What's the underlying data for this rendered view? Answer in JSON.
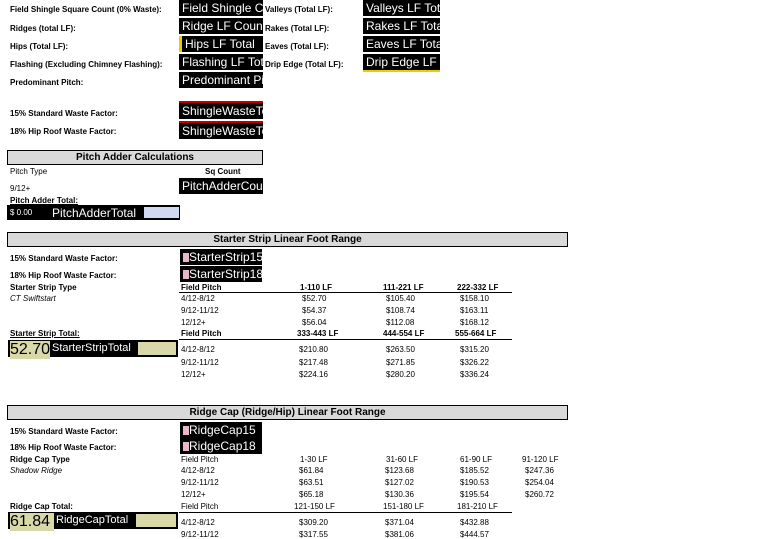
{
  "top_labels": {
    "field_shingle": "Field Shingle Square Count (0% Waste):",
    "ridges": "Ridges (total LF):",
    "hips": "Hips (Total LF):",
    "flashing": "Flashing (Excluding Chimney Flashing):",
    "predominant_pitch": "Predominant Pitch:",
    "waste15": "15% Standard Waste Factor:",
    "waste18": "18% Hip Roof Waste Factor:",
    "valleys": "Valleys (Total LF):",
    "rakes": "Rakes (Total LF):",
    "eaves": "Eaves (Total LF):",
    "drip_edge": "Drip Edge (Total LF):"
  },
  "top_fields": {
    "field_shingle": "Field Shingle Count",
    "ridges": "Ridge LF Count",
    "hips": "Hips LF Total",
    "flashing": "Flashing LF Total",
    "predominant_pitch": "Predominant Pitch",
    "waste15": "ShingleWasteTotal15",
    "waste18": "ShingleWasteTotal18",
    "valleys": "Valleys LF Total",
    "rakes": "Rakes LF Total",
    "eaves": "Eaves LF Total",
    "drip_edge": "Drip Edge LF Total"
  },
  "pitch_adder": {
    "title": "Pitch Adder Calculations",
    "col_pitch_type": "Pitch Type",
    "col_sq_count": "Sq Count",
    "row_label": "9/12+",
    "row_field": "PitchAdderCount",
    "total_label": "Pitch Adder Total:",
    "total_value": "$ 0.00",
    "total_field": "PitchAdderTotal"
  },
  "starter": {
    "title": "Starter Strip Linear Foot Range",
    "waste15": "15% Standard Waste Factor:",
    "waste18": "18% Hip Roof Waste Factor:",
    "field15": "StarterStrip15",
    "field18": "StarterStrip18",
    "type_label": "Starter Strip Type",
    "type_value": "CT Swiftstart",
    "total_label": "Starter Strip Total:",
    "total_value": "52.70",
    "total_field": "StarterStripTotal",
    "table1": {
      "headers": [
        "Field Pitch",
        "1-110 LF",
        "111-221 LF",
        "222-332 LF"
      ],
      "rows": [
        [
          "4/12-8/12",
          "$52.70",
          "$105.40",
          "$158.10"
        ],
        [
          "9/12-11/12",
          "$54.37",
          "$108.74",
          "$163.11"
        ],
        [
          "12/12+",
          "$56.04",
          "$112.08",
          "$168.12"
        ]
      ]
    },
    "table2": {
      "headers": [
        "Field Pitch",
        "333-443 LF",
        "444-554 LF",
        "555-664 LF"
      ],
      "rows": [
        [
          "4/12-8/12",
          "$210.80",
          "$263.50",
          "$315.20"
        ],
        [
          "9/12-11/12",
          "$217.48",
          "$271.85",
          "$326.22"
        ],
        [
          "12/12+",
          "$224.16",
          "$280.20",
          "$336.24"
        ]
      ]
    }
  },
  "ridge": {
    "title": "Ridge Cap (Ridge/Hip) Linear Foot Range",
    "waste15": "15% Standard Waste Factor:",
    "waste18": "18% Hip Roof Waste Factor:",
    "field15": "RidgeCap15",
    "field18": "RidgeCap18",
    "type_label": "Ridge Cap Type",
    "type_value": "Shadow Ridge",
    "total_label": "Ridge Cap Total:",
    "total_value": "61.84",
    "total_field": "RidgeCapTotal",
    "table1": {
      "headers": [
        "Field Pitch",
        "1-30 LF",
        "31-60 LF",
        "61-90 LF",
        "91-120 LF"
      ],
      "rows": [
        [
          "4/12-8/12",
          "$61.84",
          "$123.68",
          "$185.52",
          "$247.36"
        ],
        [
          "9/12-11/12",
          "$63.51",
          "$127.02",
          "$190.53",
          "$254.04"
        ],
        [
          "12/12+",
          "$65.18",
          "$130.36",
          "$195.54",
          "$260.72"
        ]
      ]
    },
    "table2": {
      "headers": [
        "Field Pitch",
        "121-150 LF",
        "151-180 LF",
        "181-210 LF"
      ],
      "rows": [
        [
          "4/12-8/12",
          "$309.20",
          "$371.04",
          "$432.88"
        ],
        [
          "9/12-11/12",
          "$317.55",
          "$381.06",
          "$444.57"
        ]
      ]
    }
  }
}
